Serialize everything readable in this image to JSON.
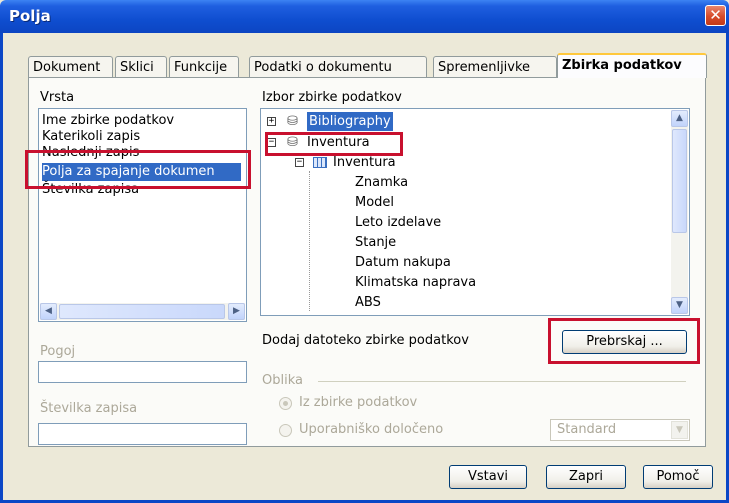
{
  "window": {
    "title": "Polja",
    "close_glyph": "✕"
  },
  "tabs": [
    {
      "label": "Dokument"
    },
    {
      "label": "Sklici"
    },
    {
      "label": "Funkcije"
    },
    {
      "label": "Podatki o dokumentu"
    },
    {
      "label": "Spremenljivke"
    },
    {
      "label": "Zbirka podatkov"
    }
  ],
  "active_tab": "Zbirka podatkov",
  "type_list": {
    "heading": "Vrsta",
    "items": [
      {
        "label": "Ime zbirke podatkov",
        "selected": false
      },
      {
        "label": "Katerikoli zapis",
        "selected": false
      },
      {
        "label": "Naslednji zapis",
        "selected": false
      },
      {
        "label": "Polja za spajanje dokumen",
        "selected": true
      },
      {
        "label": "Številka zapisa",
        "selected": false
      }
    ]
  },
  "db_tree": {
    "heading": "Izbor zbirke podatkov",
    "nodes": [
      {
        "label": "Bibliography",
        "expander": "+",
        "icon": "database-icon",
        "selected": true
      },
      {
        "label": "Inventura",
        "expander": "−",
        "icon": "database-icon",
        "selected": false
      },
      {
        "label": "Inventura",
        "expander": "−",
        "icon": "table-icon",
        "selected": false
      },
      {
        "label": "Znamka"
      },
      {
        "label": "Model"
      },
      {
        "label": "Leto izdelave"
      },
      {
        "label": "Stanje"
      },
      {
        "label": "Datum nakupa"
      },
      {
        "label": "Klimatska naprava"
      },
      {
        "label": "ABS"
      }
    ]
  },
  "add_db": {
    "label": "Dodaj datoteko zbirke podatkov",
    "browse_button": "Prebrskaj ..."
  },
  "condition": {
    "label": "Pogoj",
    "value": ""
  },
  "record_number": {
    "label": "Številka zapisa",
    "value": ""
  },
  "format": {
    "legend": "Oblika",
    "options": [
      {
        "label": "Iz zbirke podatkov",
        "checked": true
      },
      {
        "label": "Uporabniško določeno",
        "checked": false
      }
    ],
    "format_select": "Standard"
  },
  "buttons": {
    "insert": "Vstavi",
    "close": "Zapri",
    "help": "Pomoč"
  },
  "colors": {
    "title_bar": "#0f4ed0",
    "selection": "#316ac5",
    "highlight_box": "#c8102e",
    "active_tab_accent": "#ffc83c"
  }
}
